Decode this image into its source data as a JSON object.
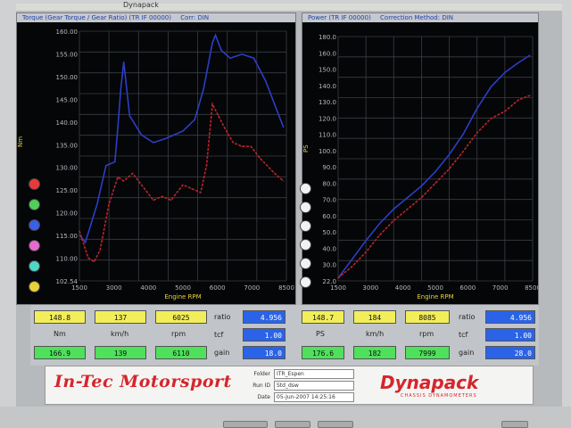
{
  "window": {
    "title": "Dynapack"
  },
  "left_panel": {
    "header": [
      "Torque (Gear Torque / Gear Ratio) (TR  IF 00000)",
      "Corr: DIN"
    ],
    "y_axis_label": "Nm",
    "x_axis_label": "Engine RPM",
    "x_ticks": [
      "1500",
      "3000",
      "4000",
      "5000",
      "6000",
      "7000",
      "8500"
    ],
    "y_ticks": [
      "160.00",
      "155.00",
      "150.00",
      "145.00",
      "140.00",
      "135.00",
      "130.00",
      "125.00",
      "120.00",
      "115.00",
      "110.00",
      "102.54"
    ]
  },
  "right_panel": {
    "header": [
      "Power (TR  IF 00000)",
      "Correction Method: DIN"
    ],
    "y_axis_label": "PS",
    "x_axis_label": "Engine RPM",
    "x_ticks": [
      "1500",
      "3000",
      "4000",
      "5000",
      "6000",
      "7000",
      "8500"
    ],
    "y_ticks": [
      "180.0",
      "160.0",
      "150.0",
      "140.0",
      "130.0",
      "120.0",
      "110.0",
      "100.0",
      "90.0",
      "80.0",
      "70.0",
      "60.0",
      "50.0",
      "40.0",
      "30.0",
      "22.0"
    ]
  },
  "legend_colors": [
    "#e83a3a",
    "#4fd05a",
    "#3b5fe8",
    "#e86ad0",
    "#4fd6c8",
    "#e8d23a"
  ],
  "readouts": {
    "left": {
      "row1": [
        "148.8",
        "137",
        "6025"
      ],
      "row2": [
        "Nm",
        "km/h",
        "rpm"
      ],
      "row3": [
        "166.9",
        "139",
        "6110"
      ],
      "side_labels": [
        "ratio",
        "tcf",
        "gain"
      ],
      "side_values": [
        "4.956",
        "1.00",
        "18.0"
      ]
    },
    "right": {
      "row1": [
        "148.7",
        "184",
        "8085"
      ],
      "row2": [
        "PS",
        "km/h",
        "rpm"
      ],
      "row3": [
        "176.6",
        "182",
        "7999"
      ],
      "side_labels": [
        "ratio",
        "tcf",
        "gain"
      ],
      "side_values": [
        "4.956",
        "1.00",
        "28.0"
      ]
    }
  },
  "banner": {
    "brand_left": "In-Tec Motorsport",
    "folder_label": "Folder",
    "folder_value": "ITR_Espen",
    "run_label": "Run ID",
    "run_value": "Std_dsw",
    "date_label": "Date",
    "date_value": "05-Jun-2007  14:25:16",
    "brand_right": "Dynapack",
    "brand_sub": "CHASSIS DYNAMOMETERS"
  },
  "chart_data": [
    {
      "type": "line",
      "title": "",
      "xlabel": "Engine RPM",
      "ylabel": "Nm",
      "xlim": [
        1500,
        8500
      ],
      "ylim": [
        100,
        165
      ],
      "grid": true,
      "series": [
        {
          "color": "#2c3ec8",
          "x": [
            1500,
            1700,
            1900,
            2100,
            2400,
            2700,
            2800,
            2900,
            3000,
            3200,
            3600,
            4000,
            4400,
            5000,
            5400,
            5700,
            5900,
            6000,
            6100,
            6300,
            6600,
            7000,
            7400,
            7800,
            8100,
            8400
          ],
          "y": [
            112,
            110,
            115,
            120,
            130,
            131,
            140,
            150,
            157,
            143,
            138,
            136,
            137,
            139,
            142,
            150,
            158,
            162,
            164,
            160,
            158,
            159,
            158,
            152,
            146,
            140
          ]
        },
        {
          "color": "#b8262c",
          "x": [
            1500,
            1800,
            2000,
            2200,
            2500,
            2800,
            3000,
            3300,
            3600,
            4000,
            4300,
            4600,
            5000,
            5300,
            5600,
            5800,
            6000,
            6200,
            6400,
            6700,
            7000,
            7300,
            7600,
            8100,
            8400
          ],
          "y": [
            113,
            106,
            105,
            108,
            120,
            127,
            126,
            128,
            125,
            121,
            122,
            121,
            125,
            124,
            123,
            130,
            146,
            143,
            140,
            136,
            135,
            135,
            132,
            128,
            126
          ]
        }
      ]
    },
    {
      "type": "line",
      "title": "",
      "xlabel": "Engine RPM",
      "ylabel": "PS",
      "xlim": [
        1500,
        8500
      ],
      "ylim": [
        20,
        190
      ],
      "grid": true,
      "series": [
        {
          "color": "#2c3ec8",
          "x": [
            1500,
            2000,
            2500,
            3000,
            3500,
            4000,
            4500,
            5000,
            5500,
            6000,
            6500,
            7000,
            7500,
            8000,
            8400
          ],
          "y": [
            22,
            35,
            48,
            60,
            70,
            78,
            86,
            96,
            108,
            122,
            140,
            155,
            165,
            172,
            177
          ]
        },
        {
          "color": "#b8262c",
          "x": [
            1500,
            2000,
            2500,
            3000,
            3500,
            4000,
            4500,
            5000,
            5500,
            6000,
            6500,
            7000,
            7500,
            8000,
            8400
          ],
          "y": [
            22,
            30,
            40,
            52,
            62,
            70,
            78,
            88,
            98,
            110,
            123,
            133,
            138,
            146,
            149
          ]
        }
      ]
    }
  ]
}
